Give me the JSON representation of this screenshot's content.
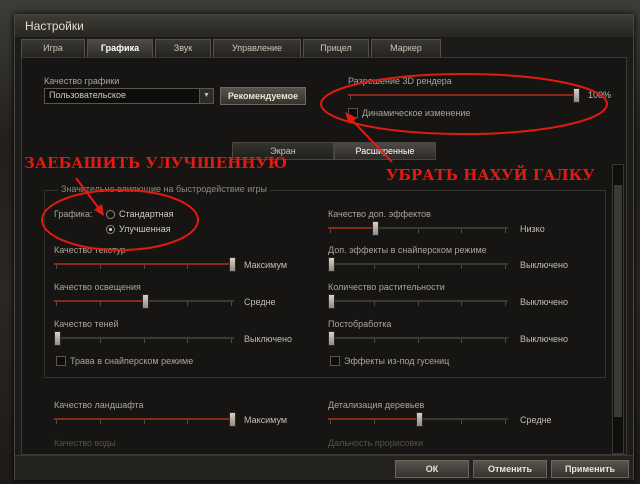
{
  "window": {
    "title": "Настройки"
  },
  "tabs": [
    "Игра",
    "Графика",
    "Звук",
    "Управление",
    "Прицел",
    "Маркер"
  ],
  "graphics": {
    "quality_label": "Качество графики",
    "quality_value": "Пользовательское",
    "recommended_button": "Рекомендуемое",
    "resolution_label": "Разрешение 3D рендера",
    "resolution_value": "100%",
    "resolution_level": 1.0,
    "dynamic_label": "Динамическое изменение"
  },
  "subtabs": [
    "Экран",
    "Расширенные"
  ],
  "group_title": "Значительно влияющие на быстродействие игры",
  "graphics_mode": {
    "label": "Графика:",
    "option1": "Стандартная",
    "option2": "Улучшенная",
    "selected": "Улучшенная"
  },
  "left_settings": [
    {
      "label": "Качество текстур",
      "value": "Максимум",
      "level": 1.0
    },
    {
      "label": "Качество освещения",
      "value": "Средне",
      "level": 0.5
    },
    {
      "label": "Качество теней",
      "value": "Выключено",
      "level": 0.0
    }
  ],
  "right_settings": [
    {
      "label": "Качество доп. эффектов",
      "value": "Низко",
      "level": 0.25
    },
    {
      "label": "Доп. эффекты в снайперском режиме",
      "value": "Выключено",
      "level": 0.0
    },
    {
      "label": "Количество растительности",
      "value": "Выключено",
      "level": 0.0
    },
    {
      "label": "Постобработка",
      "value": "Выключено",
      "level": 0.0
    }
  ],
  "checkboxes": {
    "grass": "Трава в снайперском режиме",
    "tracks": "Эффекты из-под гусениц"
  },
  "bottom_settings": {
    "landscape_label": "Качество ландшафта",
    "landscape_value": "Максимум",
    "landscape_level": 1.0,
    "trees_label": "Детализация деревьев",
    "trees_value": "Средне",
    "trees_level": 0.5,
    "water_label": "Качество воды",
    "draw_distance_label": "Дальность прорисовки"
  },
  "footer": {
    "ok": "ОК",
    "cancel": "Отменить",
    "apply": "Применить"
  },
  "annotations": {
    "left": "ЗАЕБАШИТЬ УЛУЧШЕННУЮ",
    "right": "УБРАТЬ НАХУЙ ГАЛКУ"
  },
  "colors": {
    "annotation": "#e21b12",
    "slider_fill": "#8a2a1a"
  }
}
